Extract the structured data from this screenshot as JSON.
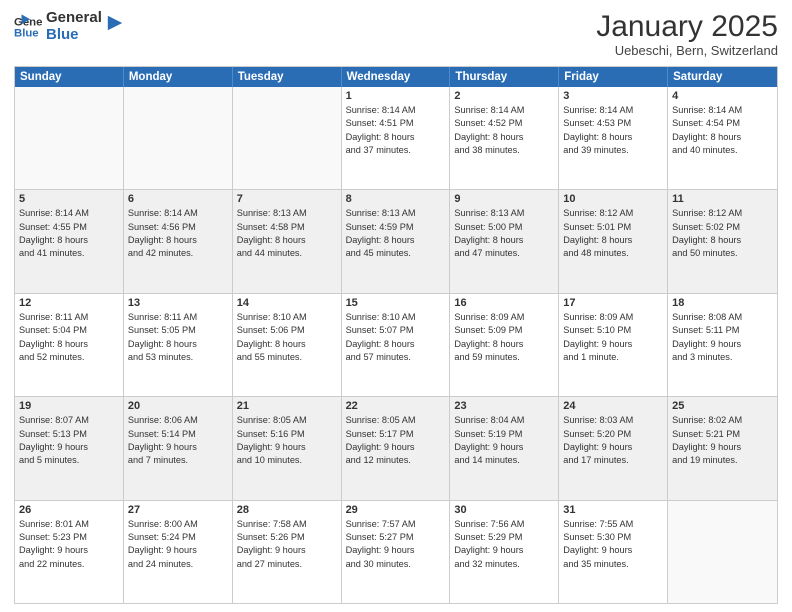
{
  "logo": {
    "line1": "General",
    "line2": "Blue"
  },
  "title": "January 2025",
  "location": "Uebeschi, Bern, Switzerland",
  "header": {
    "days": [
      "Sunday",
      "Monday",
      "Tuesday",
      "Wednesday",
      "Thursday",
      "Friday",
      "Saturday"
    ]
  },
  "weeks": [
    {
      "cells": [
        {
          "day": "",
          "empty": true
        },
        {
          "day": "",
          "empty": true
        },
        {
          "day": "",
          "empty": true
        },
        {
          "day": "1",
          "info": "Sunrise: 8:14 AM\nSunset: 4:51 PM\nDaylight: 8 hours\nand 37 minutes."
        },
        {
          "day": "2",
          "info": "Sunrise: 8:14 AM\nSunset: 4:52 PM\nDaylight: 8 hours\nand 38 minutes."
        },
        {
          "day": "3",
          "info": "Sunrise: 8:14 AM\nSunset: 4:53 PM\nDaylight: 8 hours\nand 39 minutes."
        },
        {
          "day": "4",
          "info": "Sunrise: 8:14 AM\nSunset: 4:54 PM\nDaylight: 8 hours\nand 40 minutes."
        }
      ]
    },
    {
      "cells": [
        {
          "day": "5",
          "info": "Sunrise: 8:14 AM\nSunset: 4:55 PM\nDaylight: 8 hours\nand 41 minutes."
        },
        {
          "day": "6",
          "info": "Sunrise: 8:14 AM\nSunset: 4:56 PM\nDaylight: 8 hours\nand 42 minutes."
        },
        {
          "day": "7",
          "info": "Sunrise: 8:13 AM\nSunset: 4:58 PM\nDaylight: 8 hours\nand 44 minutes."
        },
        {
          "day": "8",
          "info": "Sunrise: 8:13 AM\nSunset: 4:59 PM\nDaylight: 8 hours\nand 45 minutes."
        },
        {
          "day": "9",
          "info": "Sunrise: 8:13 AM\nSunset: 5:00 PM\nDaylight: 8 hours\nand 47 minutes."
        },
        {
          "day": "10",
          "info": "Sunrise: 8:12 AM\nSunset: 5:01 PM\nDaylight: 8 hours\nand 48 minutes."
        },
        {
          "day": "11",
          "info": "Sunrise: 8:12 AM\nSunset: 5:02 PM\nDaylight: 8 hours\nand 50 minutes."
        }
      ]
    },
    {
      "cells": [
        {
          "day": "12",
          "info": "Sunrise: 8:11 AM\nSunset: 5:04 PM\nDaylight: 8 hours\nand 52 minutes."
        },
        {
          "day": "13",
          "info": "Sunrise: 8:11 AM\nSunset: 5:05 PM\nDaylight: 8 hours\nand 53 minutes."
        },
        {
          "day": "14",
          "info": "Sunrise: 8:10 AM\nSunset: 5:06 PM\nDaylight: 8 hours\nand 55 minutes."
        },
        {
          "day": "15",
          "info": "Sunrise: 8:10 AM\nSunset: 5:07 PM\nDaylight: 8 hours\nand 57 minutes."
        },
        {
          "day": "16",
          "info": "Sunrise: 8:09 AM\nSunset: 5:09 PM\nDaylight: 8 hours\nand 59 minutes."
        },
        {
          "day": "17",
          "info": "Sunrise: 8:09 AM\nSunset: 5:10 PM\nDaylight: 9 hours\nand 1 minute."
        },
        {
          "day": "18",
          "info": "Sunrise: 8:08 AM\nSunset: 5:11 PM\nDaylight: 9 hours\nand 3 minutes."
        }
      ]
    },
    {
      "cells": [
        {
          "day": "19",
          "info": "Sunrise: 8:07 AM\nSunset: 5:13 PM\nDaylight: 9 hours\nand 5 minutes."
        },
        {
          "day": "20",
          "info": "Sunrise: 8:06 AM\nSunset: 5:14 PM\nDaylight: 9 hours\nand 7 minutes."
        },
        {
          "day": "21",
          "info": "Sunrise: 8:05 AM\nSunset: 5:16 PM\nDaylight: 9 hours\nand 10 minutes."
        },
        {
          "day": "22",
          "info": "Sunrise: 8:05 AM\nSunset: 5:17 PM\nDaylight: 9 hours\nand 12 minutes."
        },
        {
          "day": "23",
          "info": "Sunrise: 8:04 AM\nSunset: 5:19 PM\nDaylight: 9 hours\nand 14 minutes."
        },
        {
          "day": "24",
          "info": "Sunrise: 8:03 AM\nSunset: 5:20 PM\nDaylight: 9 hours\nand 17 minutes."
        },
        {
          "day": "25",
          "info": "Sunrise: 8:02 AM\nSunset: 5:21 PM\nDaylight: 9 hours\nand 19 minutes."
        }
      ]
    },
    {
      "cells": [
        {
          "day": "26",
          "info": "Sunrise: 8:01 AM\nSunset: 5:23 PM\nDaylight: 9 hours\nand 22 minutes."
        },
        {
          "day": "27",
          "info": "Sunrise: 8:00 AM\nSunset: 5:24 PM\nDaylight: 9 hours\nand 24 minutes."
        },
        {
          "day": "28",
          "info": "Sunrise: 7:58 AM\nSunset: 5:26 PM\nDaylight: 9 hours\nand 27 minutes."
        },
        {
          "day": "29",
          "info": "Sunrise: 7:57 AM\nSunset: 5:27 PM\nDaylight: 9 hours\nand 30 minutes."
        },
        {
          "day": "30",
          "info": "Sunrise: 7:56 AM\nSunset: 5:29 PM\nDaylight: 9 hours\nand 32 minutes."
        },
        {
          "day": "31",
          "info": "Sunrise: 7:55 AM\nSunset: 5:30 PM\nDaylight: 9 hours\nand 35 minutes."
        },
        {
          "day": "",
          "empty": true
        }
      ]
    }
  ]
}
